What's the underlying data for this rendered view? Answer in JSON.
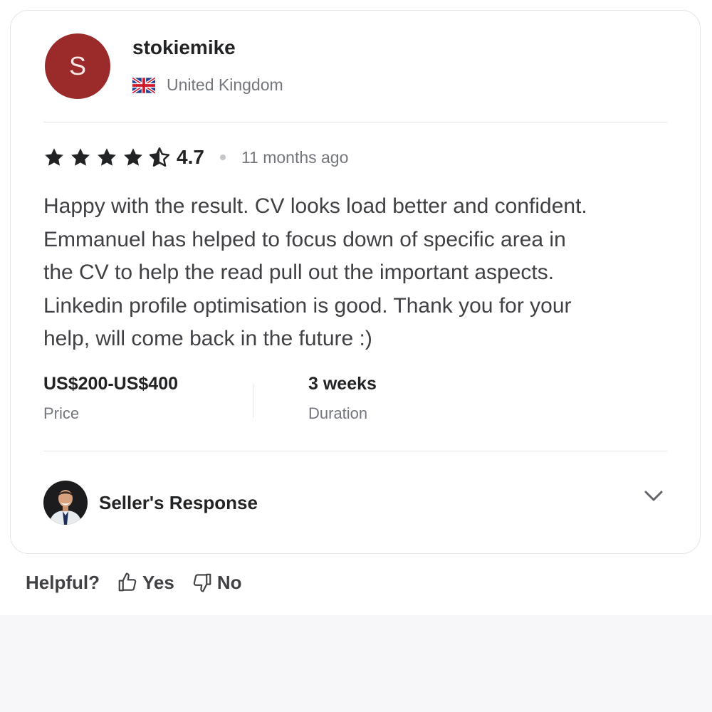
{
  "review": {
    "reviewer": {
      "avatar_initial": "S",
      "avatar_color": "#9b2b2b",
      "username": "stokiemike",
      "country": "United Kingdom",
      "flag_icon": "uk-flag-icon"
    },
    "rating": {
      "value": "4.7",
      "stars_filled": 4,
      "stars_half": 1,
      "stars_total": 5
    },
    "time_ago": "11 months ago",
    "text": "Happy with the result. CV looks load better and confident.\nEmmanuel has helped to focus down of specific area in\nthe CV to help the read pull out the important aspects.\nLinkedin profile optimisation is good. Thank you for your\nhelp, will come back in the future :)",
    "price": {
      "value": "US$200-US$400",
      "label": "Price"
    },
    "duration": {
      "value": "3 weeks",
      "label": "Duration"
    },
    "seller_response": {
      "label": "Seller's Response",
      "expand_icon": "chevron-down-icon"
    }
  },
  "feedback": {
    "label": "Helpful?",
    "yes_label": "Yes",
    "no_label": "No",
    "yes_icon": "thumbs-up-icon",
    "no_icon": "thumbs-down-icon"
  }
}
